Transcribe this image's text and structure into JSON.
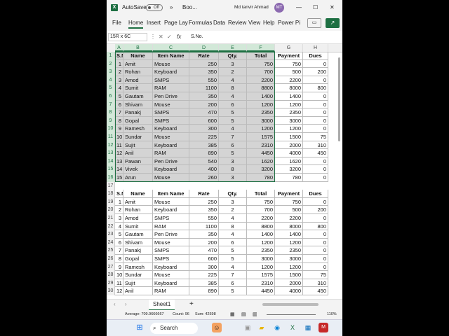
{
  "titlebar": {
    "autosave_label": "AutoSave",
    "autosave_state": "Off",
    "more": "»",
    "filename": "Boo...",
    "user_name": "Md tanvir Ahmad",
    "avatar_initials": "MT",
    "minimize": "—",
    "maximize": "☐",
    "close": "✕"
  },
  "ribbon": {
    "tabs": [
      "File",
      "Home",
      "Insert",
      "Page Lay",
      "Formulas",
      "Data",
      "Review",
      "View",
      "Help",
      "Power Pi"
    ],
    "share_icon": "share-icon",
    "comment_icon": "comment-icon"
  },
  "formula_bar": {
    "name_box": "15R x 6C",
    "fx": "fx",
    "value": "S.No."
  },
  "columns": [
    "A",
    "B",
    "C",
    "D",
    "E",
    "F",
    "G",
    "H"
  ],
  "selected_columns": [
    "A",
    "B",
    "C",
    "D",
    "E",
    "F"
  ],
  "headers": [
    "S.No.",
    "Name",
    "Item Name",
    "Rate",
    "Qty.",
    "Total",
    "Payment",
    "Dues"
  ],
  "table1": [
    [
      1,
      "Amit",
      "Mouse",
      250,
      3,
      750,
      750,
      0
    ],
    [
      2,
      "Rohan",
      "Keyboard",
      350,
      2,
      700,
      500,
      200
    ],
    [
      3,
      "Amod",
      "SMPS",
      550,
      4,
      2200,
      2200,
      0
    ],
    [
      4,
      "Sumit",
      "RAM",
      1100,
      8,
      8800,
      8000,
      800
    ],
    [
      5,
      "Gautam",
      "Pen Drive",
      350,
      4,
      1400,
      1400,
      0
    ],
    [
      6,
      "Shivam",
      "Mouse",
      200,
      6,
      1200,
      1200,
      0
    ],
    [
      7,
      "Panakj",
      "SMPS",
      470,
      5,
      2350,
      2350,
      0
    ],
    [
      8,
      "Gopal",
      "SMPS",
      600,
      5,
      3000,
      3000,
      0
    ],
    [
      9,
      "Ramesh",
      "Keyboard",
      300,
      4,
      1200,
      1200,
      0
    ],
    [
      10,
      "Sundar",
      "Mouse",
      225,
      7,
      1575,
      1500,
      75
    ],
    [
      11,
      "Sujit",
      "Keyboard",
      385,
      6,
      2310,
      2000,
      310
    ],
    [
      12,
      "Anil",
      "RAM",
      890,
      5,
      4450,
      4000,
      450
    ],
    [
      13,
      "Pawan",
      "Pen Drive",
      540,
      3,
      1620,
      1620,
      0
    ],
    [
      14,
      "Vivek",
      "Keyboard",
      400,
      8,
      3200,
      3200,
      0
    ],
    [
      15,
      "Arun",
      "Mouse",
      260,
      3,
      780,
      780,
      0
    ]
  ],
  "table2": [
    [
      1,
      "Amit",
      "Mouse",
      250,
      3,
      750,
      750,
      0
    ],
    [
      2,
      "Rohan",
      "Keyboard",
      350,
      2,
      700,
      500,
      200
    ],
    [
      3,
      "Amod",
      "SMPS",
      550,
      4,
      2200,
      2200,
      0
    ],
    [
      4,
      "Sumit",
      "RAM",
      1100,
      8,
      8800,
      8000,
      800
    ],
    [
      5,
      "Gautam",
      "Pen Drive",
      350,
      4,
      1400,
      1400,
      0
    ],
    [
      6,
      "Shivam",
      "Mouse",
      200,
      6,
      1200,
      1200,
      0
    ],
    [
      7,
      "Panakj",
      "SMPS",
      470,
      5,
      2350,
      2350,
      0
    ],
    [
      8,
      "Gopal",
      "SMPS",
      600,
      5,
      3000,
      3000,
      0
    ],
    [
      9,
      "Ramesh",
      "Keyboard",
      300,
      4,
      1200,
      1200,
      0
    ],
    [
      10,
      "Sundar",
      "Mouse",
      225,
      7,
      1575,
      1500,
      75
    ],
    [
      11,
      "Sujit",
      "Keyboard",
      385,
      6,
      2310,
      2000,
      310
    ],
    [
      12,
      "Anil",
      "RAM",
      890,
      5,
      4450,
      4000,
      450
    ]
  ],
  "sheet_tab": "Sheet1",
  "add_sheet": "+",
  "status": {
    "average": "Average: 709.9666667",
    "count": "Count: 96",
    "sum": "Sum: 42598",
    "zoom": "110%"
  },
  "taskbar": {
    "search_placeholder": "Search"
  },
  "colors": {
    "accent": "#1d6f42",
    "selection_fill": "#d4d4d4"
  }
}
